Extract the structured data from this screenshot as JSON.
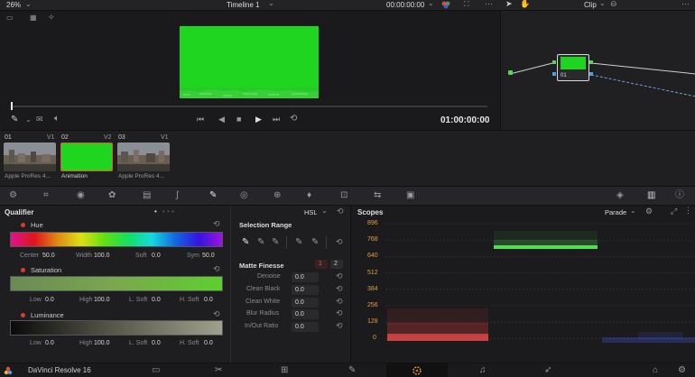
{
  "topbar": {
    "zoom": "26%",
    "timeline_title": "Timeline 1",
    "timecode": "00:00:00:00",
    "node_mode": "Clip"
  },
  "viewer": {
    "playhead_timecode": "01:00:00:00",
    "frame_color": "#1fd51f"
  },
  "clips": [
    {
      "num": "01",
      "track": "V1",
      "label": "Apple ProRes 4..."
    },
    {
      "num": "02",
      "track": "V2",
      "label": "Animation"
    },
    {
      "num": "03",
      "track": "V1",
      "label": "Apple ProRes 4..."
    }
  ],
  "node": {
    "label": "01"
  },
  "qualifier": {
    "title": "Qualifier",
    "mode": "HSL",
    "hue": {
      "label": "Hue",
      "fields": [
        {
          "label": "Center",
          "value": "50.0"
        },
        {
          "label": "Width",
          "value": "100.0"
        },
        {
          "label": "Soft",
          "value": "0.0"
        },
        {
          "label": "Sym",
          "value": "50.0"
        }
      ]
    },
    "saturation": {
      "label": "Saturation",
      "fields": [
        {
          "label": "Low",
          "value": "0.0"
        },
        {
          "label": "High",
          "value": "100.0"
        },
        {
          "label": "L. Soft",
          "value": "0.0"
        },
        {
          "label": "H. Soft",
          "value": "0.0"
        }
      ]
    },
    "luminance": {
      "label": "Luminance",
      "fields": [
        {
          "label": "Low",
          "value": "0.0"
        },
        {
          "label": "High",
          "value": "100.0"
        },
        {
          "label": "L. Soft",
          "value": "0.0"
        },
        {
          "label": "H. Soft",
          "value": "0.0"
        }
      ]
    }
  },
  "selection_range": {
    "title": "Selection Range",
    "matte_finesse": "Matte Finesse",
    "tab1": "1",
    "tab2": "2",
    "params": [
      {
        "label": "Denoise",
        "value": "0.0"
      },
      {
        "label": "Clean Black",
        "value": "0.0"
      },
      {
        "label": "Clean White",
        "value": "0.0"
      },
      {
        "label": "Blur Radius",
        "value": "0.0"
      },
      {
        "label": "In/Out Ratio",
        "value": "0.0"
      }
    ]
  },
  "scopes": {
    "title": "Scopes",
    "mode": "Parade",
    "scale": [
      "896",
      "768",
      "640",
      "512",
      "384",
      "256",
      "128",
      "0"
    ]
  },
  "bottombar": {
    "app_name": "DaVinci Resolve 16"
  }
}
